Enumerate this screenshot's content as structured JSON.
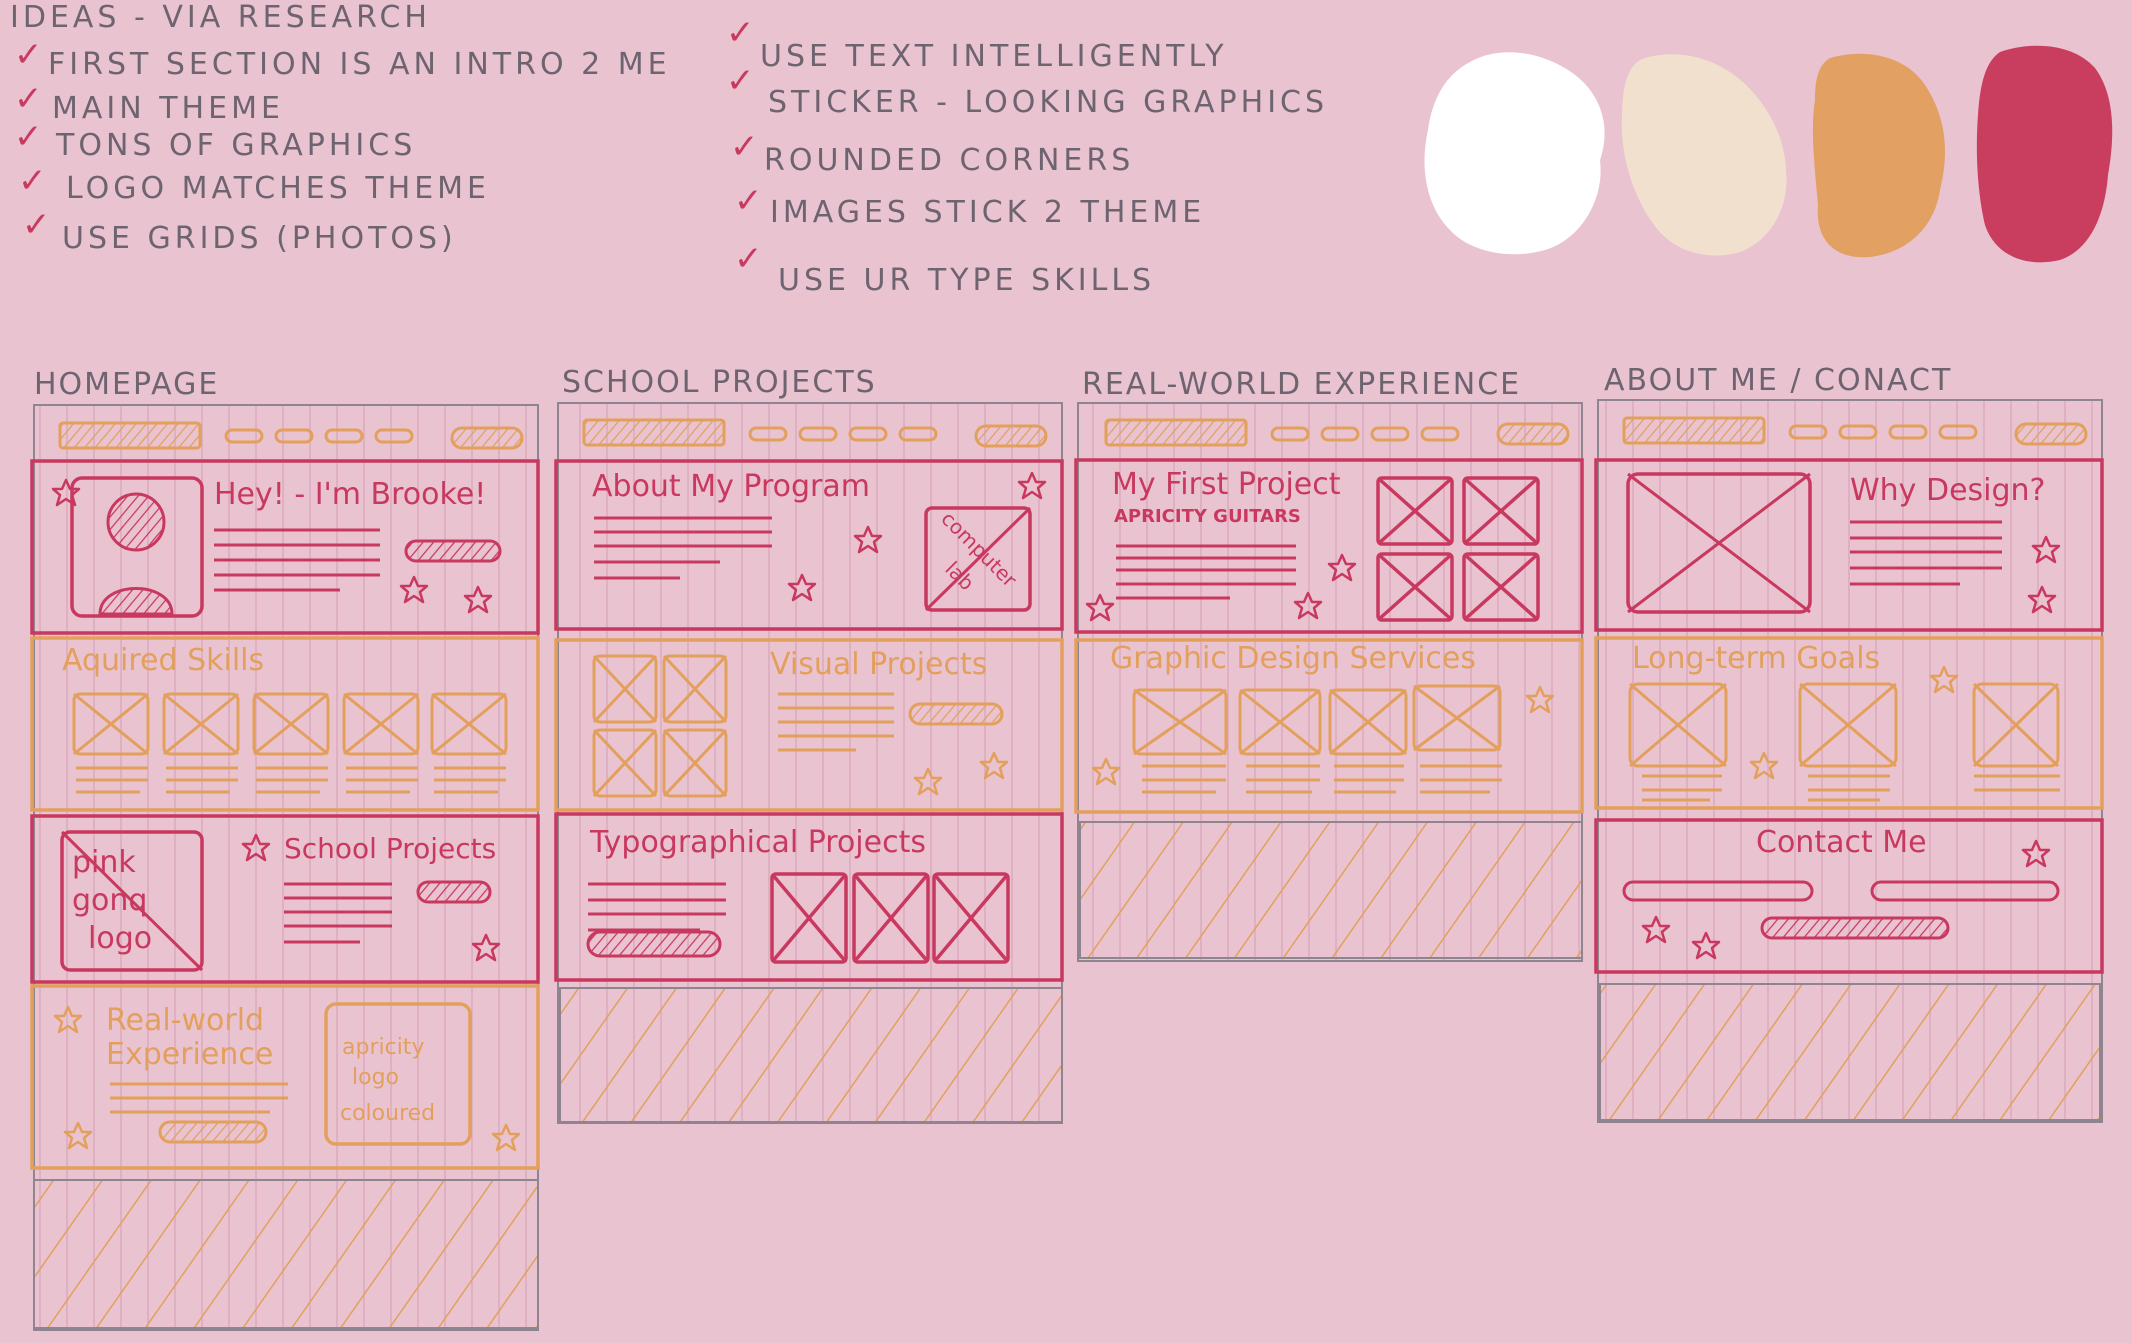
{
  "ideas": {
    "heading": "IDEAS - VIA RESEARCH",
    "left": [
      "FIRST SECTION IS AN INTRO 2 ME",
      "MAIN THEME",
      "TONS OF GRAPHICS",
      "LOGO MATCHES THEME",
      "USE GRIDS (PHOTOS)"
    ],
    "right": [
      "USE TEXT INTELLIGENTLY",
      "STICKER - LOOKING GRAPHICS",
      "ROUNDED CORNERS",
      "IMAGES STICK 2 THEME",
      "USE UR TYPE SKILLS"
    ]
  },
  "palette": [
    "#ffffff",
    "#f2e0cf",
    "#e2a062",
    "#c93d5f"
  ],
  "pages": {
    "homepage": {
      "title": "HOMEPAGE",
      "hero_heading": "Hey! - I'm Brooke!",
      "skills_heading": "Aquired Skills",
      "projects_heading": "School Projects",
      "logo_line1": "pink",
      "logo_line2": "gonq",
      "logo_line3": "logo",
      "experience_line1": "Real-world",
      "experience_line2": "Experience",
      "apricity_line1": "apricity",
      "apricity_line2": "logo",
      "apricity_line3": "coloured"
    },
    "school": {
      "title": "SCHOOL PROJECTS",
      "program_heading": "About My Program",
      "lab_line1": "computer",
      "lab_line2": "lab",
      "visual_heading": "Visual Projects",
      "typo_heading": "Typographical Projects"
    },
    "experience": {
      "title": "REAL-WORLD EXPERIENCE",
      "project_heading": "My First Project",
      "project_sub": "APRICITY GUITARS",
      "services_heading": "Graphic Design Services"
    },
    "about": {
      "title": "ABOUT ME / CONACT",
      "why_heading": "Why Design?",
      "goals_heading": "Long-term Goals",
      "contact_heading": "Contact Me"
    }
  }
}
